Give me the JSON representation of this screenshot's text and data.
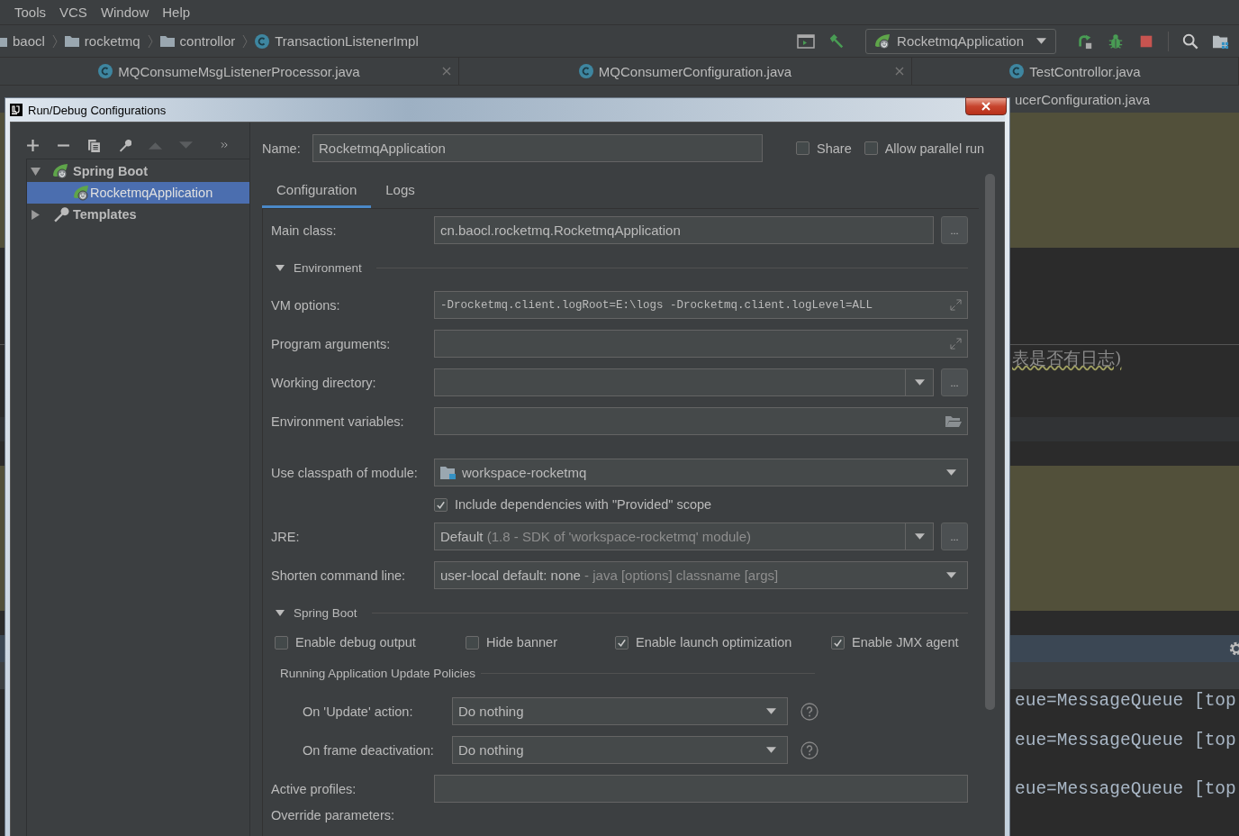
{
  "menu": [
    "Tools",
    "VCS",
    "Window",
    "Help"
  ],
  "breadcrumbs": [
    {
      "label": "baocl",
      "kind": "folder"
    },
    {
      "label": "rocketmq",
      "kind": "folder"
    },
    {
      "label": "controllor",
      "kind": "folder"
    },
    {
      "label": "TransactionListenerImpl",
      "kind": "class"
    }
  ],
  "run_configuration": "RocketmqApplication",
  "editor_tabs": [
    {
      "label": "MQConsumeMsgListenerProcessor.java",
      "closable": true
    },
    {
      "label": "MQConsumerConfiguration.java",
      "closable": true
    },
    {
      "label": "TestControllor.java",
      "closable": false
    }
  ],
  "background_editor": {
    "tab_fragment": "ucerConfiguration.java",
    "code_fragment": "表是否有日志)",
    "console_lines": [
      "eue=MessageQueue [top",
      "eue=MessageQueue [top",
      "eue=MessageQueue [top"
    ]
  },
  "dialog": {
    "title": "Run/Debug Configurations",
    "tree": [
      {
        "label": "Spring Boot",
        "expanded": true,
        "selected": false,
        "children": [
          {
            "label": "RocketmqApplication",
            "selected": true
          }
        ]
      },
      {
        "label": "Templates",
        "expanded": false,
        "selected": false
      }
    ],
    "name_label": "Name:",
    "name": "RocketmqApplication",
    "options": [
      {
        "label": "Share",
        "checked": false
      },
      {
        "label": "Allow parallel run",
        "checked": false
      }
    ],
    "tabs": [
      {
        "label": "Configuration",
        "selected": true
      },
      {
        "label": "Logs",
        "selected": false
      }
    ],
    "rows": [
      {
        "kind": "field",
        "label": "Main class:",
        "value": "cn.baocl.rocketmq.RocketmqApplication",
        "browse": "..."
      },
      {
        "kind": "section",
        "label": "Environment"
      },
      {
        "kind": "expand",
        "label": "VM options:",
        "value": "-Drocketmq.client.logRoot=E:\\logs -Drocketmq.client.logLevel=ALL"
      },
      {
        "kind": "expand",
        "label": "Program arguments:"
      },
      {
        "kind": "combo",
        "label": "Working directory:",
        "browse": "..."
      },
      {
        "kind": "folder",
        "label": "Environment variables:"
      },
      {
        "kind": "module",
        "label": "Use classpath of module:",
        "value": "workspace-rocketmq"
      },
      {
        "kind": "checkbox",
        "label": "Include dependencies with \"Provided\" scope",
        "checked": true
      },
      {
        "kind": "combo",
        "label": "JRE:",
        "value": "Default",
        "hint": "(1.8 - SDK of 'workspace-rocketmq' module)",
        "browse": "..."
      },
      {
        "kind": "dropdown",
        "label": "Shorten command line:",
        "value": "user-local default: none",
        "hint": "- java [options] classname [args]"
      },
      {
        "kind": "section",
        "label": "Spring Boot"
      },
      {
        "kind": "checks",
        "items": [
          {
            "label": "Enable debug output",
            "checked": false
          },
          {
            "label": "Hide banner",
            "checked": false
          },
          {
            "label": "Enable launch optimization",
            "checked": true
          },
          {
            "label": "Enable JMX agent",
            "checked": true
          }
        ]
      },
      {
        "kind": "subsection",
        "label": "Running Application Update Policies"
      },
      {
        "kind": "policy",
        "label": "On 'Update' action:",
        "value": "Do nothing"
      },
      {
        "kind": "policy",
        "label": "On frame deactivation:",
        "value": "Do nothing"
      },
      {
        "kind": "field",
        "label": "Active profiles:"
      },
      {
        "kind": "label",
        "label": "Override parameters:"
      }
    ]
  }
}
